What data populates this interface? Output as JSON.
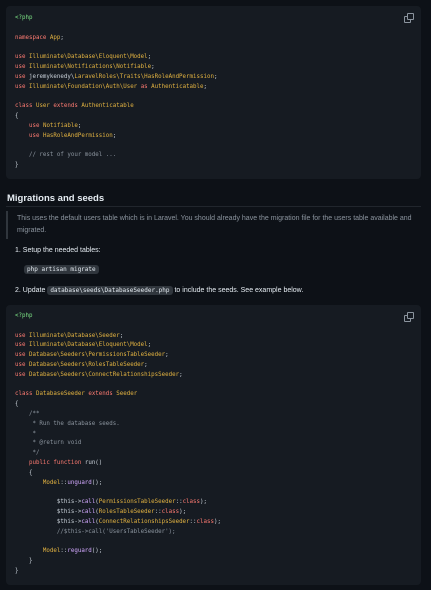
{
  "code_block_1": {
    "lines": [
      "<?php",
      "",
      "namespace App;",
      "",
      "use Illuminate\\Database\\Eloquent\\Model;",
      "use Illuminate\\Notifications\\Notifiable;",
      "use jeremykenedy\\LaravelRoles\\Traits\\HasRoleAndPermission;",
      "use Illuminate\\Foundation\\Auth\\User as Authenticatable;",
      "",
      "class User extends Authenticatable",
      "{",
      "    use Notifiable;",
      "    use HasRoleAndPermission;",
      "",
      "    // rest of your model ...",
      "}"
    ],
    "copy_icon": "copy-icon"
  },
  "section": {
    "heading": "Migrations and seeds",
    "note": "This uses the default users table which is in Laravel. You should already have the migration file for the users table available and migrated.",
    "step1": "1. Setup the needed tables:",
    "command": "php artisan migrate",
    "step2_prefix": "2. Update",
    "step2_code": "database\\seeds\\DatabaseSeeder.php",
    "step2_suffix": "to include the seeds. See example below."
  },
  "code_block_2": {
    "lines": [
      "<?php",
      "",
      "use Illuminate\\Database\\Seeder;",
      "use Illuminate\\Database\\Eloquent\\Model;",
      "use Database\\Seeders\\PermissionsTableSeeder;",
      "use Database\\Seeders\\RolesTableSeeder;",
      "use Database\\Seeders\\ConnectRelationshipsSeeder;",
      "",
      "class DatabaseSeeder extends Seeder",
      "{",
      "    /**",
      "     * Run the database seeds.",
      "     *",
      "     * @return void",
      "     */",
      "    public function run()",
      "    {",
      "        Model::unguard();",
      "",
      "            $this->call(PermissionsTableSeeder::class);",
      "            $this->call(RolesTableSeeder::class);",
      "            $this->call(ConnectRelationshipsSeeder::class);",
      "            //$this->call('UsersTableSeeder');",
      "",
      "        Model::reguard();",
      "    }",
      "}"
    ],
    "copy_icon": "copy-icon"
  }
}
